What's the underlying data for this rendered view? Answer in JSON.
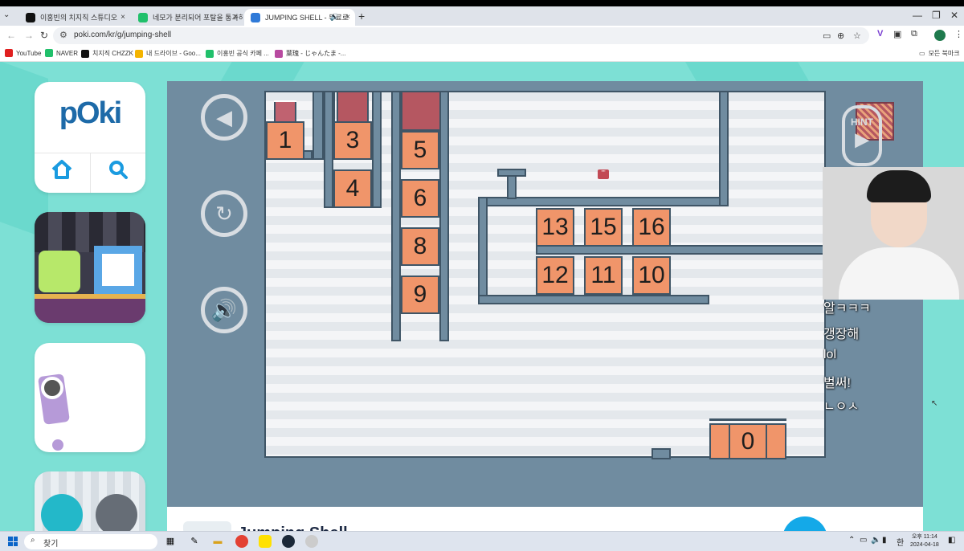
{
  "browser": {
    "tabs": [
      {
        "title": "이홍빈의 치지직 스튜디오",
        "favcolor": "#111111"
      },
      {
        "title": "네모가 분리되어 포탈을 통과하",
        "favcolor": "#21c06b"
      },
      {
        "title": "JUMPING SHELL - 무료로",
        "favcolor": "#2f7ad8"
      }
    ],
    "close_glyph": "×",
    "new_tab_glyph": "+",
    "url": "poki.com/kr/g/jumping-shell",
    "bookmarks": [
      {
        "label": "YouTube",
        "color": "#e02020"
      },
      {
        "label": "NAVER",
        "color": "#21c06b"
      },
      {
        "label": "치지직 CHZZK",
        "color": "#111111"
      },
      {
        "label": "내 드라이브 - Goo...",
        "color": "#f4b400"
      },
      {
        "label": "이홍빈 공식 카페 ...",
        "color": "#21c06b"
      },
      {
        "label": "葉瑰 - じゃんたま -...",
        "color": "#b84aa0"
      }
    ],
    "all_bookmarks": "모든 북마크"
  },
  "poki": {
    "logo": "pOki",
    "home_icon": "home-icon",
    "search_icon": "search-icon"
  },
  "game": {
    "hint_label": "HINT",
    "player_eyes": "\"\"",
    "blocks": [
      "1",
      "3",
      "4",
      "5",
      "6",
      "8",
      "9",
      "13",
      "15",
      "16",
      "12",
      "11",
      "10",
      "0"
    ],
    "footer_title": "Jumping Shell"
  },
  "chat": [
    "알ㅋㅋㅋ",
    "갱장해",
    "lol",
    "벌써!",
    "ㄴㅇㅅ"
  ],
  "taskbar": {
    "search_placeholder": "찾기",
    "time": "오후 11:14",
    "date": "2024-04-18"
  }
}
